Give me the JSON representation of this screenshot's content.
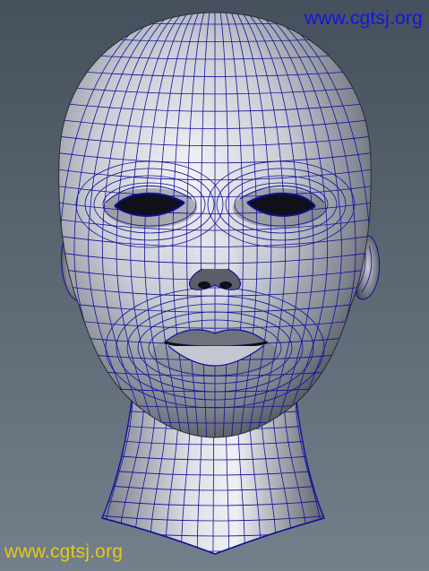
{
  "watermark": {
    "top": "www.cgtsj.org",
    "bottom": "www.cgtsj.org",
    "top_color": "#1414e6",
    "bottom_color": "#e6c814"
  },
  "colors": {
    "wire": "#10109a",
    "skin_light": "#f2f3f7",
    "skin_mid": "#9ea3ad",
    "skin_dark": "#3b3e46",
    "background_top": "#45505c",
    "background_bottom": "#73808c"
  },
  "icons": {
    "model": "head-mesh-icon"
  }
}
